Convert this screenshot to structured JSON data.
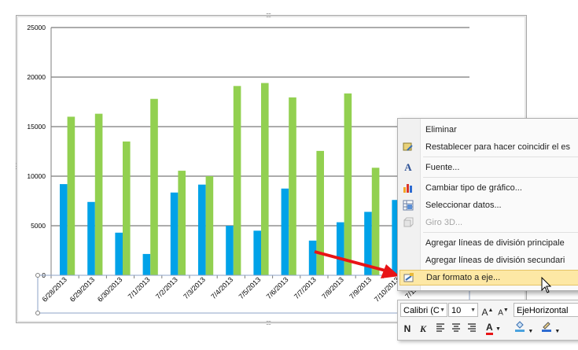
{
  "chart_data": {
    "type": "bar",
    "categories": [
      "6/28/2013",
      "6/29/2013",
      "6/30/2013",
      "7/1/2013",
      "7/2/2013",
      "7/3/2013",
      "7/4/2013",
      "7/5/2013",
      "7/6/2013",
      "7/7/2013",
      "7/8/2013",
      "7/9/2013",
      "7/10/2013",
      "7/11/2013"
    ],
    "series": [
      {
        "color": "#00a2e8",
        "values": [
          9200,
          7400,
          4300,
          2150,
          8350,
          9150,
          5000,
          4500,
          8750,
          3500,
          5350,
          6400,
          7600,
          null
        ]
      },
      {
        "color": "#92d050",
        "values": [
          16000,
          16300,
          13500,
          17800,
          10550,
          10000,
          19100,
          19400,
          17950,
          12550,
          18350,
          10850,
          null,
          null
        ]
      }
    ],
    "y_ticks": [
      "25000",
      "20000",
      "15000",
      "10000",
      "5000",
      "0"
    ],
    "ylim": [
      0,
      25000
    ],
    "grid": true,
    "axis_labels_visible": [
      "6/28/2013",
      "6/29/2013",
      "6/30/2013",
      "7/1/2013",
      "7/2/2013",
      "7/3/2013",
      "7/4/2013",
      "7/5/2013",
      "7/6/2013",
      "7/7/2013",
      "7/8/2013",
      "7/9/2013",
      "7/10/2013",
      "7/11/201"
    ]
  },
  "context_menu": {
    "items": [
      {
        "label": "Eliminar",
        "icon": "none",
        "disabled": false
      },
      {
        "label": "Restablecer para hacer coincidir el es",
        "icon": "reset-style-icon",
        "disabled": false
      },
      {
        "label": "Fuente...",
        "icon": "font-icon",
        "disabled": false
      },
      {
        "label": "Cambiar tipo de gráfico...",
        "icon": "chart-type-icon",
        "disabled": false
      },
      {
        "label": "Seleccionar datos...",
        "icon": "select-data-icon",
        "disabled": false
      },
      {
        "label": "Giro 3D...",
        "icon": "rotation-3d-icon",
        "disabled": true
      },
      {
        "label": "Agregar líneas de división principale",
        "icon": "none",
        "disabled": false
      },
      {
        "label": "Agregar líneas de división secundari",
        "icon": "none",
        "disabled": false
      },
      {
        "label": "Dar formato a eje...",
        "icon": "format-axis-icon",
        "disabled": false,
        "highlighted": true
      }
    ]
  },
  "mini_toolbar": {
    "font_name": "Calibri (C",
    "font_size": "10",
    "grow_font": "A",
    "shrink_font": "A",
    "element_selector": "EjeHorizontal",
    "bold": "N",
    "italic": "K",
    "font_color_glyph": "A"
  },
  "colors": {
    "series1": "#00a2e8",
    "series2": "#92d050",
    "highlight": "#fde8a5",
    "arrow": "#e81416"
  }
}
